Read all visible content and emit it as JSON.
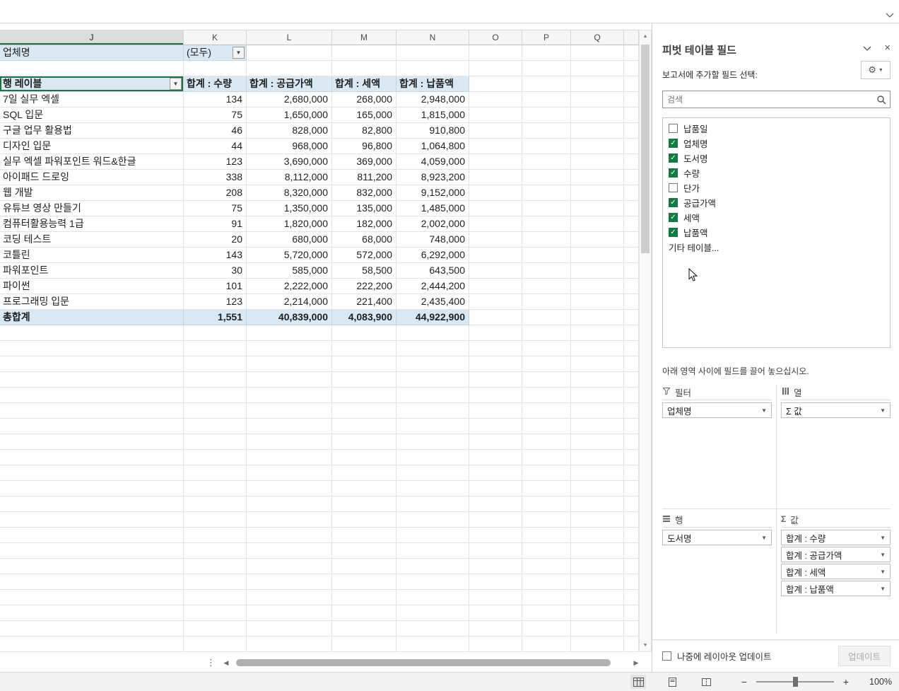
{
  "sheet": {
    "column_letters": [
      "J",
      "K",
      "L",
      "M",
      "N",
      "O",
      "P",
      "Q",
      ""
    ],
    "selected_column": "J"
  },
  "pivot": {
    "filter_label": "업체명",
    "filter_value": "(모두)",
    "row_header": "행 레이블",
    "col_headers": [
      "합계 : 수량",
      "합계 : 공급가액",
      "합계 : 세액",
      "합계 : 납품액"
    ],
    "rows": [
      {
        "label": "7일 실무 엑셀",
        "values": [
          "134",
          "2,680,000",
          "268,000",
          "2,948,000"
        ]
      },
      {
        "label": "SQL 입문",
        "values": [
          "75",
          "1,650,000",
          "165,000",
          "1,815,000"
        ]
      },
      {
        "label": "구글 업무 활용법",
        "values": [
          "46",
          "828,000",
          "82,800",
          "910,800"
        ]
      },
      {
        "label": "디자인 입문",
        "values": [
          "44",
          "968,000",
          "96,800",
          "1,064,800"
        ]
      },
      {
        "label": "실무 엑셀 파워포인트 워드&한글",
        "values": [
          "123",
          "3,690,000",
          "369,000",
          "4,059,000"
        ]
      },
      {
        "label": "아이패드 드로잉",
        "values": [
          "338",
          "8,112,000",
          "811,200",
          "8,923,200"
        ]
      },
      {
        "label": "웹 개발",
        "values": [
          "208",
          "8,320,000",
          "832,000",
          "9,152,000"
        ]
      },
      {
        "label": "유튜브 영상 만들기",
        "values": [
          "75",
          "1,350,000",
          "135,000",
          "1,485,000"
        ]
      },
      {
        "label": "컴퓨터활용능력 1급",
        "values": [
          "91",
          "1,820,000",
          "182,000",
          "2,002,000"
        ]
      },
      {
        "label": "코딩 테스트",
        "values": [
          "20",
          "680,000",
          "68,000",
          "748,000"
        ]
      },
      {
        "label": "코틀린",
        "values": [
          "143",
          "5,720,000",
          "572,000",
          "6,292,000"
        ]
      },
      {
        "label": "파워포인트",
        "values": [
          "30",
          "585,000",
          "58,500",
          "643,500"
        ]
      },
      {
        "label": "파이썬",
        "values": [
          "101",
          "2,222,000",
          "222,200",
          "2,444,200"
        ]
      },
      {
        "label": "프로그래밍 입문",
        "values": [
          "123",
          "2,214,000",
          "221,400",
          "2,435,400"
        ]
      }
    ],
    "grand_total": {
      "label": "총합계",
      "values": [
        "1,551",
        "40,839,000",
        "4,083,900",
        "44,922,900"
      ]
    }
  },
  "fields_pane": {
    "title": "피벗 테이블 필드",
    "choose_fields_label": "보고서에 추가할 필드 선택:",
    "search_placeholder": "검색",
    "fields": [
      {
        "name": "납품일",
        "checked": false
      },
      {
        "name": "업체명",
        "checked": true
      },
      {
        "name": "도서명",
        "checked": true
      },
      {
        "name": "수량",
        "checked": true
      },
      {
        "name": "단가",
        "checked": false
      },
      {
        "name": "공급가액",
        "checked": true
      },
      {
        "name": "세액",
        "checked": true
      },
      {
        "name": "납품액",
        "checked": true
      }
    ],
    "more_tables_label": "기타 테이블...",
    "drag_hint": "아래 영역 사이에 필드를 끌어 놓으십시오.",
    "areas": {
      "filter": {
        "label": "필터",
        "items": [
          "업체명"
        ]
      },
      "columns": {
        "label": "열",
        "items": [
          "Σ 값"
        ]
      },
      "rows": {
        "label": "행",
        "items": [
          "도서명"
        ]
      },
      "values": {
        "label": "값",
        "items": [
          "합계 : 수량",
          "합계 : 공급가액",
          "합계 : 세액",
          "합계 : 납품액"
        ]
      }
    },
    "defer_label": "나중에 레이아웃 업데이트",
    "update_button_label": "업데이트"
  },
  "status_bar": {
    "zoom_level": "100%"
  },
  "colors": {
    "accent_green": "#1E7145",
    "checkbox_green": "#107C41",
    "pivot_header_blue": "#D9E8F2"
  }
}
